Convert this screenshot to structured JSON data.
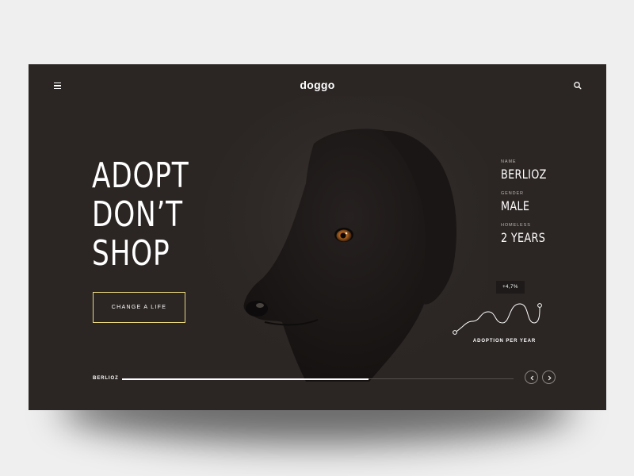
{
  "header": {
    "logo": "doggo",
    "menu_icon": "hamburger-menu-icon",
    "search_icon": "search-icon"
  },
  "hero": {
    "headline": [
      "ADOPT",
      "DON’T",
      "SHOP"
    ],
    "cta_label": "CHANGE A LIFE"
  },
  "pet": {
    "name_label": "NAME",
    "name_value": "BERLIOZ",
    "gender_label": "GENDER",
    "gender_value": "MALE",
    "homeless_label": "HOMELESS",
    "homeless_value": "2 YEARS"
  },
  "trend": {
    "badge": "+4,7%",
    "caption": "ADOPTION PER YEAR"
  },
  "slider": {
    "label": "BERLIOZ",
    "progress": 0.63,
    "prev_icon": "chevron-left-icon",
    "next_icon": "chevron-right-icon"
  },
  "colors": {
    "background": "#2b2624",
    "accent": "#e8d77e",
    "text": "#ffffff"
  }
}
